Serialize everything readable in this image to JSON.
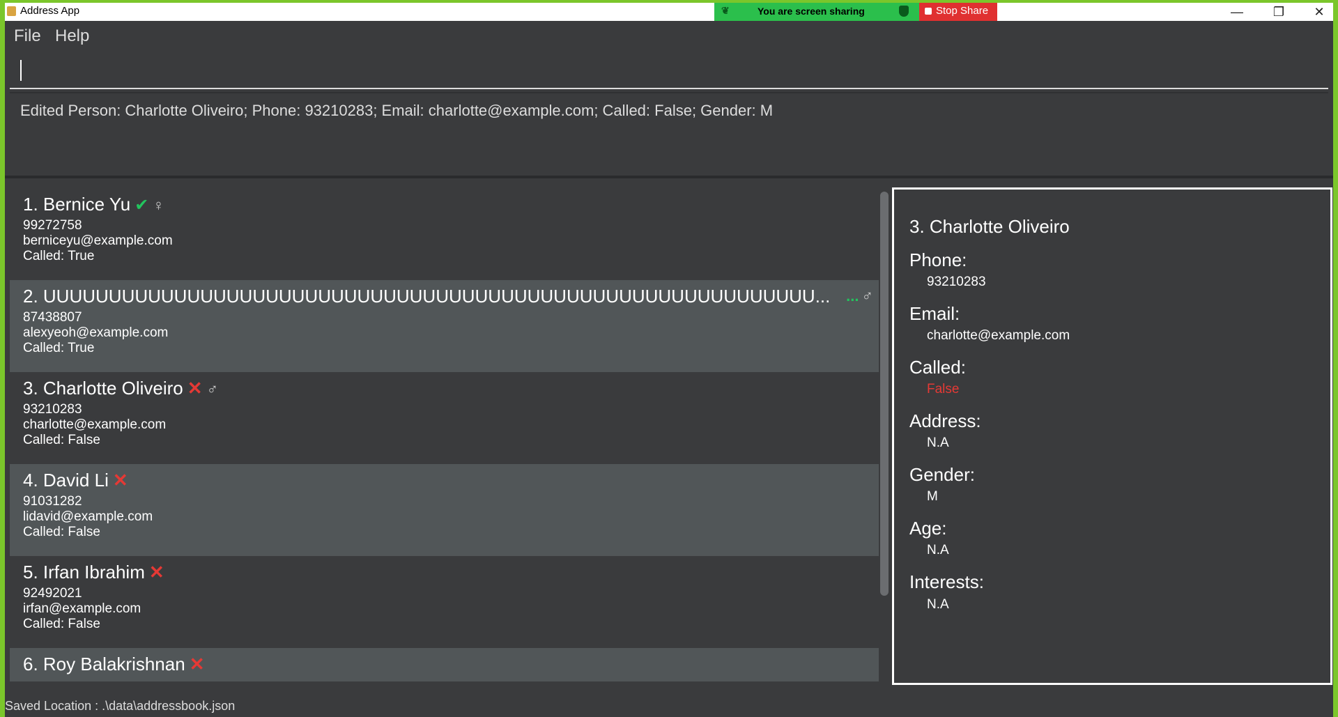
{
  "window": {
    "title": "Address App"
  },
  "share_bar": {
    "sharing_label": "You are screen sharing",
    "stop_label": "Stop Share"
  },
  "menu": {
    "file": "File",
    "help": "Help"
  },
  "command": {
    "value": ""
  },
  "result": {
    "text": "Edited Person: Charlotte Oliveiro; Phone: 93210283; Email: charlotte@example.com; Called: False; Gender: M"
  },
  "persons": [
    {
      "name": "1.  Bernice Yu",
      "phone": "99272758",
      "email": "berniceyu@example.com",
      "called": "Called: True",
      "called_mark": "✔",
      "gender_icon": "♀"
    },
    {
      "name": "2.  UUUUUUUUUUUUUUUUUUUUUUUUUUUUUUUUUUUUUUUUUUUUUUUUUUUUUUUUUUU...",
      "phone": "87438807",
      "email": "alexyeoh@example.com",
      "called": "Called: True",
      "called_mark": "...",
      "gender_icon": "♂"
    },
    {
      "name": "3.  Charlotte Oliveiro",
      "phone": "93210283",
      "email": "charlotte@example.com",
      "called": "Called: False",
      "called_mark": "✕",
      "gender_icon": "♂"
    },
    {
      "name": "4.  David Li",
      "phone": "91031282",
      "email": "lidavid@example.com",
      "called": "Called: False",
      "called_mark": "✕",
      "gender_icon": ""
    },
    {
      "name": "5.  Irfan Ibrahim",
      "phone": "92492021",
      "email": "irfan@example.com",
      "called": "Called: False",
      "called_mark": "✕",
      "gender_icon": ""
    },
    {
      "name": "6.  Roy Balakrishnan",
      "phone": "",
      "email": "",
      "called": "",
      "called_mark": "✕",
      "gender_icon": ""
    }
  ],
  "detail": {
    "title": "3.  Charlotte Oliveiro",
    "phone_label": "Phone:",
    "phone": "93210283",
    "email_label": "Email:",
    "email": "charlotte@example.com",
    "called_label": "Called:",
    "called": "False",
    "address_label": "Address:",
    "address": "N.A",
    "gender_label": "Gender:",
    "gender": "M",
    "age_label": "Age:",
    "age": "N.A",
    "interests_label": "Interests:",
    "interests": "N.A"
  },
  "status": {
    "text": "Saved Location : .\\data\\addressbook.json"
  },
  "colors": {
    "accent_green": "#22c55e",
    "error_red": "#e53935",
    "screen_share_green": "#2bbf4c"
  }
}
